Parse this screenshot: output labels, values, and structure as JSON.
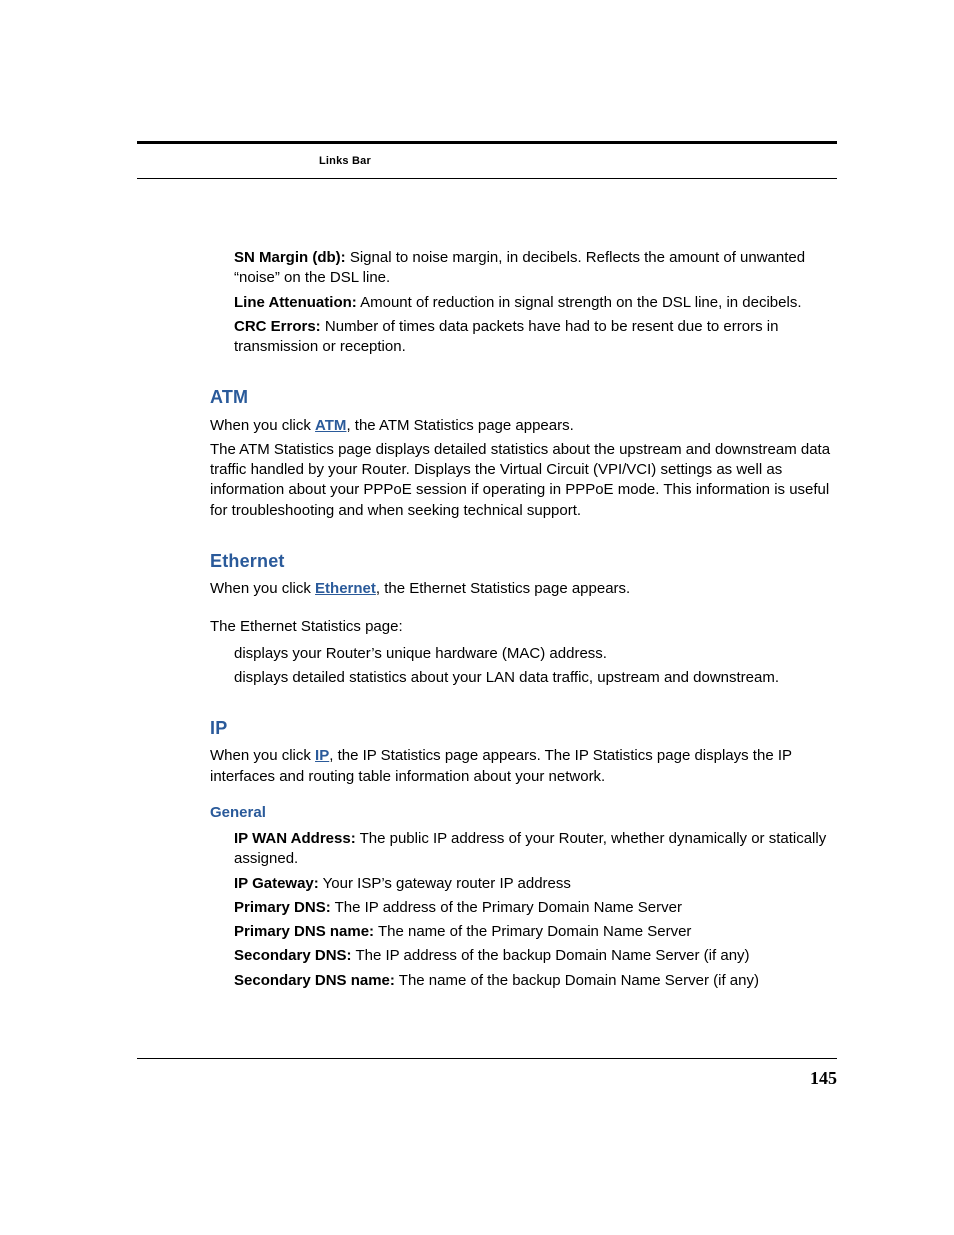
{
  "header": {
    "running": "Links Bar"
  },
  "dsl": {
    "sn_margin": {
      "term": "SN Margin (db):",
      "def": "Signal to noise margin, in decibels. Reflects the amount of unwanted “noise” on the DSL line."
    },
    "line_att": {
      "term": "Line Attenuation:",
      "def": "Amount of reduction in signal strength on the DSL line, in decibels."
    },
    "crc": {
      "term": "CRC Errors:",
      "def": "Number of times data packets have had to be resent due to errors in transmission or reception."
    }
  },
  "atm": {
    "heading": "ATM",
    "intro_pre": "When you click ",
    "link_label": "ATM",
    "intro_post": ", the ATM Statistics page appears.",
    "body": "The ATM Statistics page displays detailed statistics about the upstream and downstream data traffic handled by your Router. Displays the Virtual Circuit (VPI/VCI) settings as well as information about your PPPoE session if operating in PPPoE mode. This information is useful for troubleshooting and when seeking technical support."
  },
  "eth": {
    "heading": "Ethernet",
    "intro_pre": "When you click ",
    "link_label": "Ethernet",
    "intro_post": ", the Ethernet Statistics page appears.",
    "list_lead": "The Ethernet Statistics page:",
    "bullets": [
      "displays your Router’s unique hardware (MAC) address.",
      "displays detailed statistics about your LAN data traffic, upstream and downstream."
    ]
  },
  "ip": {
    "heading": "IP",
    "intro_pre": "When you click ",
    "link_label": "IP",
    "intro_post": ", the IP Statistics page appears. The IP Statistics page displays the IP interfaces and routing table information about your network.",
    "general_heading": "General",
    "defs": [
      {
        "term": "IP WAN Address:",
        "def": "The public IP address of your Router, whether dynamically or statically assigned."
      },
      {
        "term": "IP Gateway:",
        "def": "Your ISP’s gateway router IP address"
      },
      {
        "term": "Primary DNS:",
        "def": "The IP address of the Primary Domain Name Server"
      },
      {
        "term": "Primary DNS name:",
        "def": "The name of the Primary Domain Name Server"
      },
      {
        "term": "Secondary DNS:",
        "def": "The IP address of the backup Domain Name Server (if any)"
      },
      {
        "term": "Secondary DNS name:",
        "def": "The name of the backup Domain Name Server (if any)"
      }
    ]
  },
  "footer": {
    "page": "145"
  }
}
